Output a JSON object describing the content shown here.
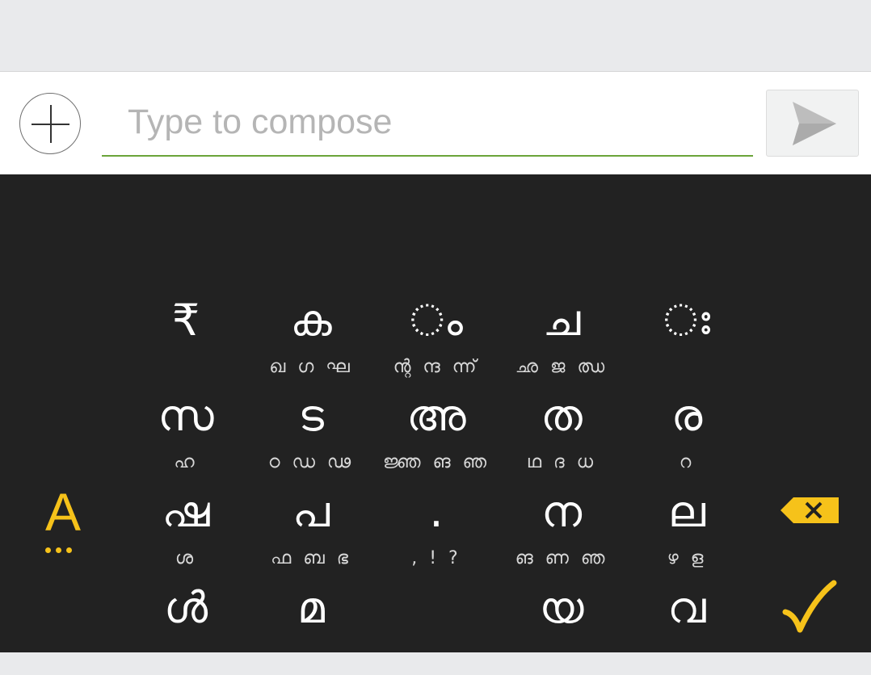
{
  "compose": {
    "placeholder": "Type to compose",
    "value": "",
    "underline_color": "#6aa43a"
  },
  "icons": {
    "add": "plus-circle-icon",
    "send": "send-arrow-icon",
    "language": "language-switch-icon",
    "delete": "backspace-icon",
    "done": "checkmark-icon"
  },
  "colors": {
    "keyboard_bg": "#222222",
    "accent": "#f6c21a",
    "key_text": "#ffffff"
  },
  "keyboard": {
    "language_key": "A",
    "rows": [
      [
        {
          "main": "₹",
          "sub": ""
        },
        {
          "main": "ക",
          "sub": "ഖ ഗ ഘ"
        },
        {
          "main": "ം",
          "sub": "ന്റ ന്ദ ന്ന്"
        },
        {
          "main": "ച",
          "sub": "ഛ ജ ഝ"
        },
        {
          "main": "ഃ",
          "sub": ""
        }
      ],
      [
        {
          "main": "സ",
          "sub": "ഹ"
        },
        {
          "main": "ട",
          "sub": "ഠ ഡ ഢ"
        },
        {
          "main": "അ",
          "sub": "ജ്ഞ ങ ഞ"
        },
        {
          "main": "ത",
          "sub": "ഥ ദ ധ"
        },
        {
          "main": "ര",
          "sub": "റ"
        }
      ],
      [
        {
          "main": "ഷ",
          "sub": "ശ"
        },
        {
          "main": "പ",
          "sub": "ഫ ബ ഭ"
        },
        {
          "main": ".",
          "sub": ", ! ?"
        },
        {
          "main": "ന",
          "sub": "ങ ണ ഞ"
        },
        {
          "main": "ല",
          "sub": "ഴ ള"
        }
      ],
      [
        {
          "main": "ൾ",
          "sub": ""
        },
        {
          "main": "മ",
          "sub": ""
        },
        {
          "main": "",
          "sub": ""
        },
        {
          "main": "യ",
          "sub": ""
        },
        {
          "main": "വ",
          "sub": ""
        }
      ]
    ]
  }
}
